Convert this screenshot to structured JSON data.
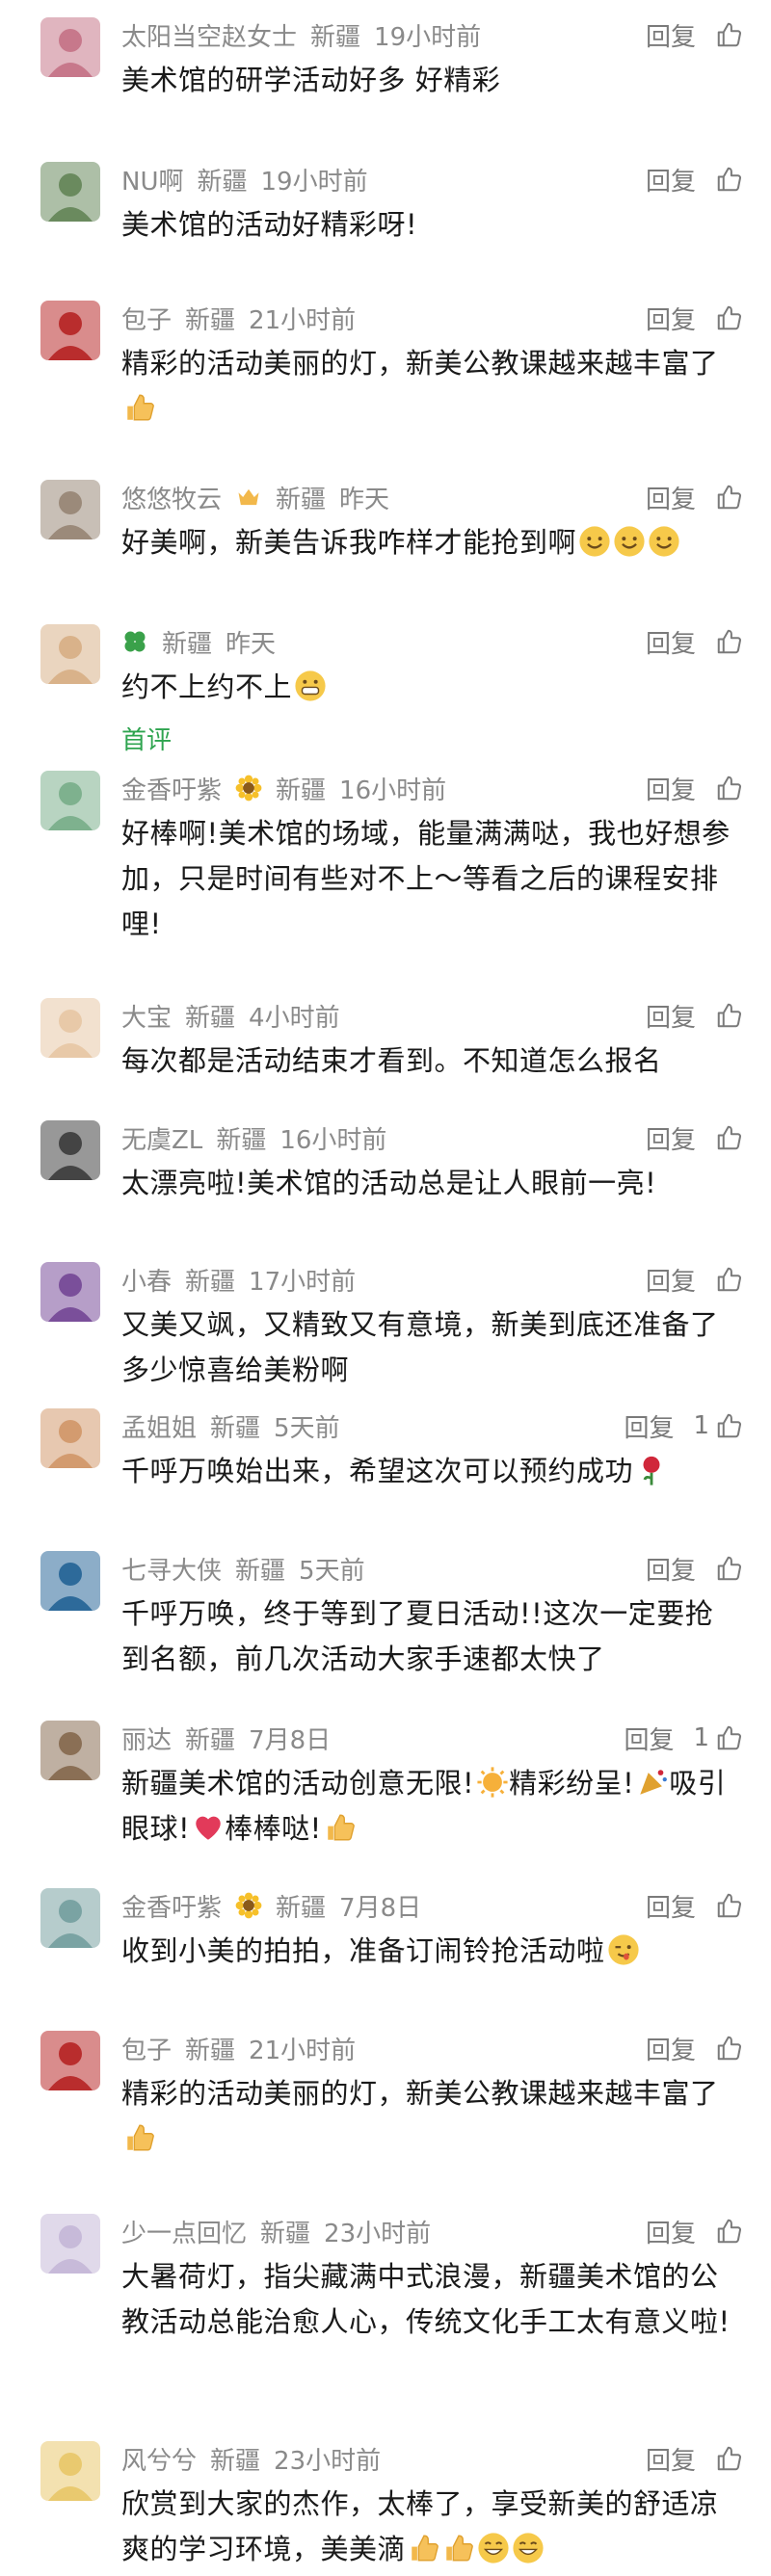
{
  "reply_label": "回复",
  "comments": [
    {
      "name": "太阳当空赵女士",
      "location": "新疆",
      "time": "19小时前",
      "text": "美术馆的研学活动好多 好精彩",
      "emojis": []
    },
    {
      "name": "NU啊",
      "location": "新疆",
      "time": "19小时前",
      "text": "美术馆的活动好精彩呀!",
      "emojis": []
    },
    {
      "name": "包子",
      "location": "新疆",
      "time": "21小时前",
      "text": "精彩的活动美丽的灯，新美公教课越来越丰富了",
      "emojis": [
        "thumbs-up"
      ]
    },
    {
      "name": "悠悠牧云",
      "location": "新疆",
      "time": "昨天",
      "text": "好美啊，新美告诉我咋样才能抢到啊",
      "emojis": [
        "smile",
        "smile",
        "smile"
      ]
    },
    {
      "name": "",
      "location": "新疆",
      "time": "昨天",
      "text": "约不上约不上",
      "emojis": [
        "grimace"
      ],
      "tag": "首评"
    },
    {
      "name": "金香吁紫",
      "location": "新疆",
      "time": "16小时前",
      "text": "好棒啊!美术馆的场域，能量满满哒，我也好想参加，只是时间有些对不上～等看之后的课程安排哩!",
      "emojis": []
    },
    {
      "name": "大宝",
      "location": "新疆",
      "time": "4小时前",
      "text": "每次都是活动结束才看到。不知道怎么报名",
      "emojis": []
    },
    {
      "name": "无虞ZL",
      "location": "新疆",
      "time": "16小时前",
      "text": "太漂亮啦!美术馆的活动总是让人眼前一亮!",
      "emojis": []
    },
    {
      "name": "小春",
      "location": "新疆",
      "time": "17小时前",
      "text": "又美又飒，又精致又有意境，新美到底还准备了多少惊喜给美粉啊",
      "emojis": []
    },
    {
      "name": "孟姐姐",
      "location": "新疆",
      "time": "5天前",
      "text": "千呼万唤始出来，希望这次可以预约成功",
      "emojis": [
        "rose"
      ],
      "likes": "1"
    },
    {
      "name": "七寻大侠",
      "location": "新疆",
      "time": "5天前",
      "text": "千呼万唤，终于等到了夏日活动!!这次一定要抢到名额，前几次活动大家手速都太快了",
      "emojis": []
    },
    {
      "name": "丽达",
      "location": "新疆",
      "time": "7月8日",
      "text": "新疆美术馆的活动创意无限!",
      "text2": "精彩纷呈!",
      "text3": "吸引眼球!",
      "text4": "棒棒哒!",
      "likes": "1"
    },
    {
      "name": "金香吁紫",
      "location": "新疆",
      "time": "7月8日",
      "text": "收到小美的拍拍，准备订闹铃抢活动啦",
      "emojis": [
        "wink"
      ]
    },
    {
      "name": "包子",
      "location": "新疆",
      "time": "21小时前",
      "text": "精彩的活动美丽的灯，新美公教课越来越丰富了",
      "emojis": [
        "thumbs-up"
      ]
    },
    {
      "name": "少一点回忆",
      "location": "新疆",
      "time": "23小时前",
      "text": "大暑荷灯，指尖藏满中式浪漫，新疆美术馆的公教活动总能治愈人心，传统文化手工太有意义啦!",
      "emojis": []
    },
    {
      "name": "风兮兮",
      "location": "新疆",
      "time": "23小时前",
      "text": "欣赏到大家的杰作，太棒了，享受新美的舒适凉爽的学习环境，美美滴",
      "emojis": [
        "thumbs-up",
        "thumbs-up",
        "grin",
        "grin"
      ]
    }
  ],
  "colors": {
    "meta": "#8a8a8a",
    "text": "#1a1a1a",
    "tag": "#2ea44f"
  }
}
